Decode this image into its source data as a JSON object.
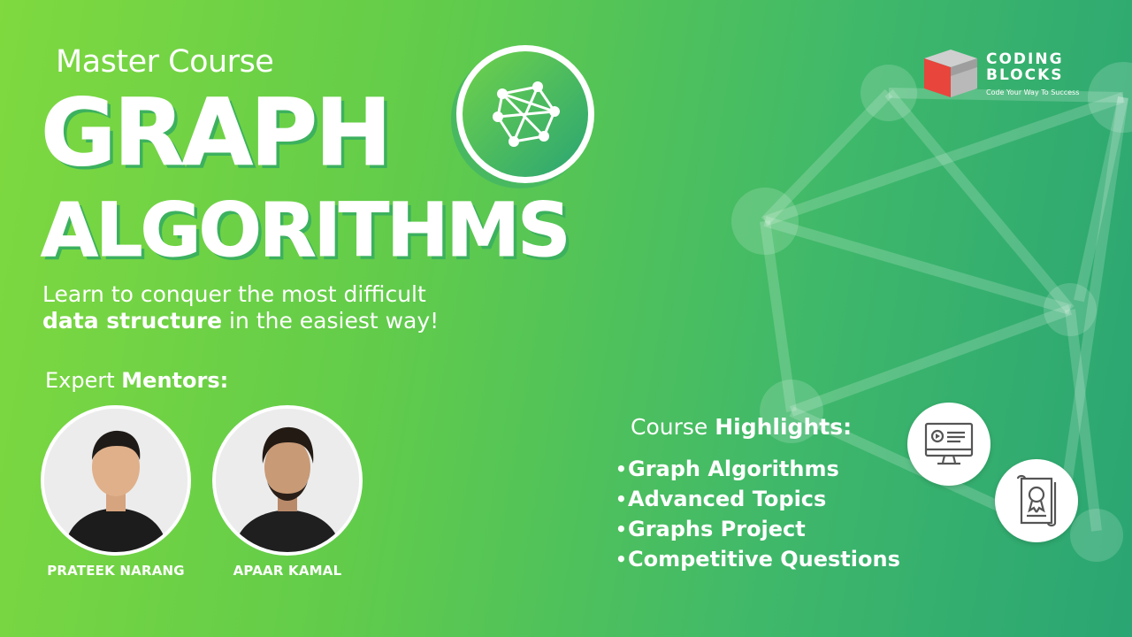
{
  "course": {
    "subtitle": "Master Course",
    "title_line1": "GRAPH",
    "title_line2": "ALGORITHMS",
    "tagline_plain": "Learn to conquer the most difficult",
    "tagline_bold": "data structure",
    "tagline_end": " in the easiest way!"
  },
  "mentors": {
    "heading_plain": "Expert ",
    "heading_bold": "Mentors:",
    "people": [
      {
        "name": "PRATEEK NARANG"
      },
      {
        "name": "APAAR KAMAL"
      }
    ]
  },
  "highlights": {
    "heading_plain": "Course ",
    "heading_bold": "Highlights:",
    "bullet": "•",
    "items": [
      "Graph Algorithms",
      "Advanced Topics",
      "Graphs Project",
      "Competitive Questions"
    ]
  },
  "brand": {
    "name_line1": "CODING",
    "name_line2": "BLOCKS",
    "tagline": "Code Your Way To Success"
  },
  "icons": {
    "graph_logo": "graph-network-icon",
    "feature_1": "video-monitor-icon",
    "feature_2": "certificate-icon",
    "brand_logo": "cube-logo-icon"
  },
  "colors": {
    "gradient_start": "#7fd93f",
    "gradient_end": "#2aa573",
    "text": "#ffffff",
    "brand_red": "#e8453c"
  }
}
